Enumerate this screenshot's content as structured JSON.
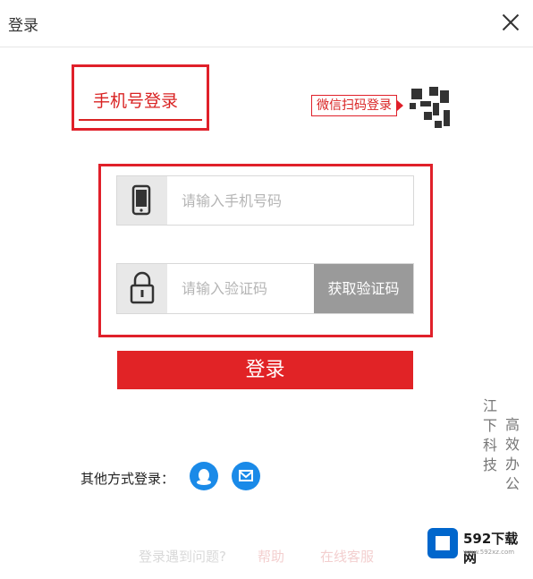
{
  "window": {
    "title": "登录",
    "close_icon": "close-icon"
  },
  "tab": {
    "label": "手机号登录"
  },
  "wechat": {
    "label": "微信扫码登录"
  },
  "phone": {
    "placeholder": "请输入手机号码",
    "icon": "phone-icon"
  },
  "code": {
    "placeholder": "请输入验证码",
    "icon": "lock-icon",
    "button": "获取验证码"
  },
  "login": {
    "label": "登录"
  },
  "other": {
    "label": "其他方式登录：",
    "icons": [
      "qq-icon",
      "mail-icon"
    ]
  },
  "help": {
    "text": "登录遇到问题?",
    "link1": "帮助",
    "link2": "在线客服"
  },
  "watermarks": {
    "line1": "江下科技",
    "line2": "高效办公"
  },
  "brand": {
    "name": "592下载网",
    "url": "www.592xz.com"
  },
  "colors": {
    "accent": "#e12326",
    "social": "#1a8ae8",
    "code_button": "#9a9a9a"
  }
}
